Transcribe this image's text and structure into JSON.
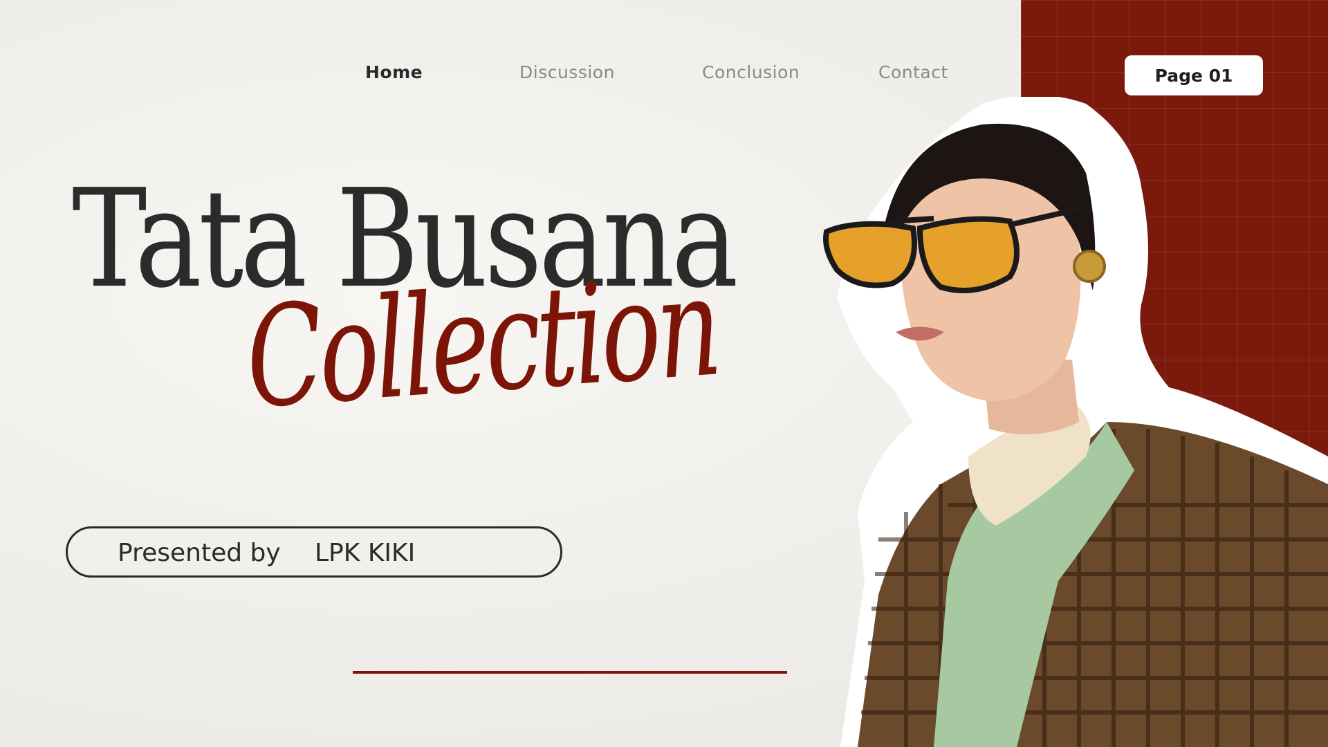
{
  "nav": {
    "items": [
      {
        "label": "Home",
        "active": true
      },
      {
        "label": "Discussion",
        "active": false
      },
      {
        "label": "Conclusion",
        "active": false
      },
      {
        "label": "Contact",
        "active": false
      }
    ]
  },
  "page_badge": {
    "label": "Page 01"
  },
  "title": {
    "main": "Tata Busana",
    "script": "Collection"
  },
  "presenter": {
    "label": "Presented by",
    "name": "LPK KIKI"
  },
  "colors": {
    "accent_red": "#7d1408",
    "panel_red": "#7b1a0c",
    "text_dark": "#2b2b2b",
    "background": "#f1efeb"
  }
}
